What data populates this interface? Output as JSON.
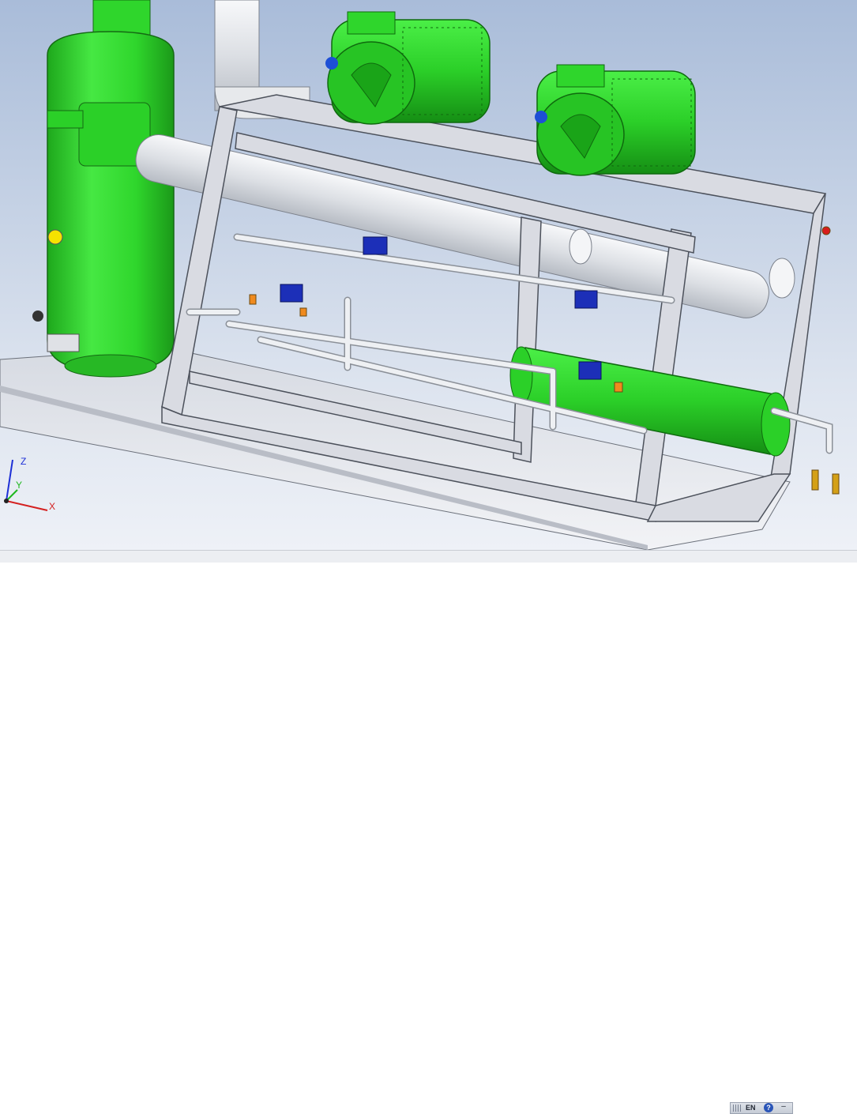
{
  "viewport": {
    "background_top": "#a9bcd9",
    "background_bottom": "#eef1f7",
    "colors": {
      "equipment_green": "#2fd62c",
      "frame_grey": "#d9dbe2",
      "pipe_grey": "#e4e6ea",
      "valve_blue": "#1c2fb8",
      "fitting_orange": "#f08a1e",
      "brass": "#d4a017",
      "red_cap": "#d81c1c"
    }
  },
  "triad": {
    "z_label": "Z",
    "y_label": "Y",
    "x_label": "X",
    "z_color": "#1d2fd6",
    "y_color": "#1fb81f",
    "x_color": "#d42020"
  },
  "taskbar": {
    "language_label": "EN",
    "help_icon": "help-icon",
    "help_glyph": "?",
    "minimize_icon": "minimize-icon",
    "minimize_glyph": "–"
  }
}
